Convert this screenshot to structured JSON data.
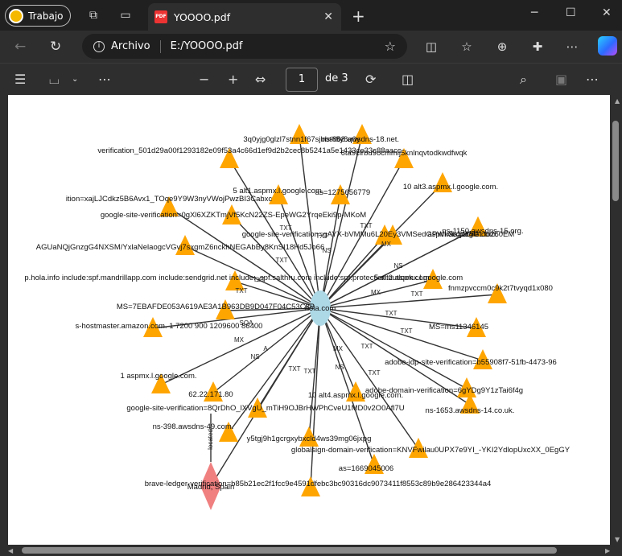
{
  "browser": {
    "profile_label": "Trabajo",
    "tab_title": "YOOOO.pdf",
    "pdf_badge": "PDF",
    "address_scheme_label": "Archivo",
    "address_path": "E:/YOOOO.pdf"
  },
  "pdf_toolbar": {
    "page_number": "1",
    "page_total": "de 3"
  },
  "graph": {
    "center": {
      "label": "hola.com",
      "color": "#add8e6"
    },
    "triangle_color": "#ffa500",
    "diamond_color": "#f08080",
    "edge_labels": [
      "TXT",
      "MX",
      "NS",
      "A",
      "SOA"
    ],
    "nodes": [
      {
        "label": "3q0yjg0glzl7stnn1f67sjbbth8y8q0y"
      },
      {
        "label": "ns-868.awsdns-18.net."
      },
      {
        "label": "verification_501d29a00f1293182e09f53a4c66d1ef9d2b2cec8b5241a5e1433ce33c88aacc"
      },
      {
        "label": "6ta9clrbu9ocmmij5knlnqvtodkwdfwqk"
      },
      {
        "label": "5 alt1.aspmx.l.google.com."
      },
      {
        "label": "as=1275656779"
      },
      {
        "label": "10 alt3.aspmx.l.google.com."
      },
      {
        "label": "ition=xajLJCdkz5B6Avx1_TOqe9Y9W3nyVWojPwzBI3Cabxc"
      },
      {
        "label": "google-site-verification=0gXl6XZKTmjVf5KcN22ZS-EpeWG2YrqeEki9p-MKoM"
      },
      {
        "label": "as=1150"
      },
      {
        "label": "aspmx.l.google.com."
      },
      {
        "label": "google-site-verification=gAYX-bVMMu6L20Ey3VMSedGPWk3vJjcLvGLtb260EM"
      },
      {
        "label": "ns-1150.awsdns-15.org."
      },
      {
        "label": "AGUaNQjGnzgG4NXSM/YxlaNelaogcVGvj7sxgmZ6nckhNEGAbBy8KnSI18Hd5Jo66"
      },
      {
        "label": "p.hola.info include:spf.mandrillapp.com include:sendgrid.net include:_spf.salthru.com include:spf.protection.outlook.com"
      },
      {
        "label": "5 alt2.aspmx.l.google.com"
      },
      {
        "label": "fnmzpvccm0c9k2t7tvyqd1x080"
      },
      {
        "label": "MS=7EBAFDE053A619AE3A1B963DB9D047F04C53C8B"
      },
      {
        "label": "s-hostmaster.amazon.com. 1 7200 900 1209600 86400"
      },
      {
        "label": "MS=ms11346145"
      },
      {
        "label": "adobe-idp-site-verification=b55908f7-51fb-4473-96"
      },
      {
        "label": "1 aspmx.l.google.com."
      },
      {
        "label": "adobe-domain-verification=6gYDg9Y1zTai6f4g"
      },
      {
        "label": "62.22.171.80"
      },
      {
        "label": "10 alt4.aspmx.l.google.com."
      },
      {
        "label": "ns-1653.awsdns-14.co.uk."
      },
      {
        "label": "google-site-verification=8QrDhO_lXVgU_mTiH9OJBrHWPhCveU1MD0v2O0Afl7U"
      },
      {
        "label": "ns-398.awsdns-49.com."
      },
      {
        "label": "y5tgj9h1gcrgxybxcld4ws39mg06jxpg"
      },
      {
        "label": "globalsign-domain-verification=KNVFwilau0UPX7e9YI_-YKI2YdlopUxcXX_0EgGY"
      },
      {
        "label": "as=1669045006"
      },
      {
        "label": "brave-ledger-verification=b85b21ec2f1fcc9e4591dfebc3bc90316dc9073411f8553c89b9e286423344a4"
      },
      {
        "label": "Madrid, Spain"
      },
      {
        "label": "located"
      }
    ]
  }
}
